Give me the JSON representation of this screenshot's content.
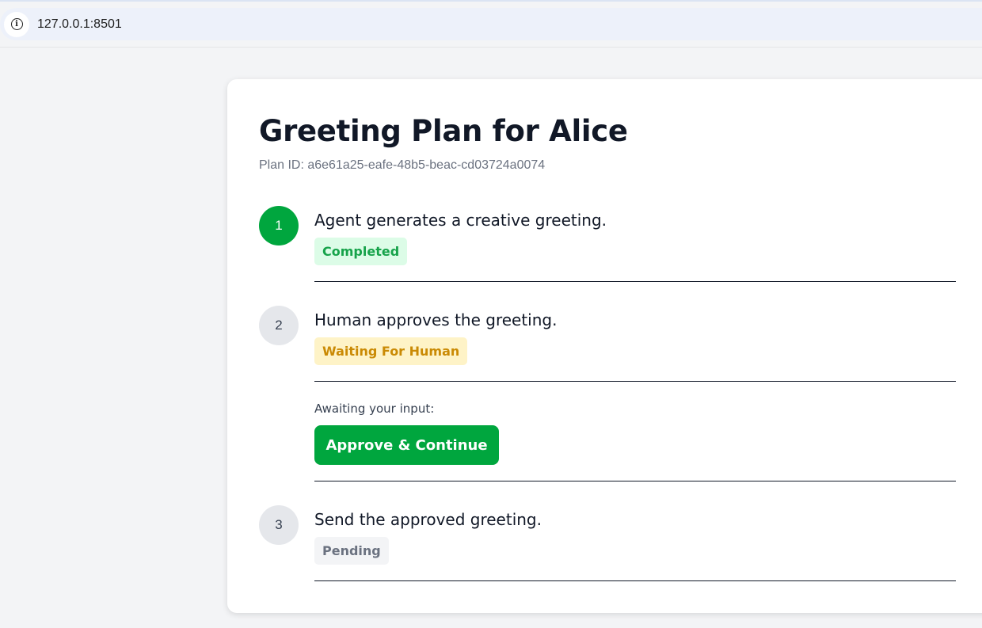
{
  "browser": {
    "url": "127.0.0.1:8501",
    "info_icon": "info-icon"
  },
  "plan": {
    "title": "Greeting Plan for Alice",
    "plan_id": "Plan ID: a6e61a25-eafe-48b5-beac-cd03724a0074",
    "steps": [
      {
        "number": "1",
        "text": "Agent generates a creative greeting.",
        "status": "Completed",
        "status_color": "#16a34a"
      },
      {
        "number": "2",
        "text": "Human approves the greeting.",
        "status": "Waiting For Human",
        "status_color": "#ca8a04"
      },
      {
        "number": "3",
        "text": "Send the approved greeting.",
        "status": "Pending",
        "status_color": "#6b7280"
      }
    ],
    "awaiting_label": "Awaiting your input:",
    "approve_label": "Approve & Continue"
  },
  "colors": {
    "accent": "#00a63e",
    "background": "#f3f4f6"
  }
}
